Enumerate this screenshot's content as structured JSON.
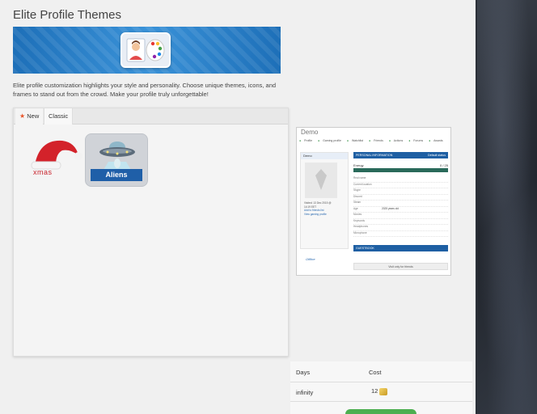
{
  "page": {
    "title": "Elite Profile Themes",
    "description": "Elite profile customization highlights your style and personality. Choose unique themes, icons, and frames to stand out from the crowd. Make your profile truly unforgettable!"
  },
  "tabs": [
    {
      "label": "New",
      "active": true
    },
    {
      "label": "Classic",
      "active": false
    }
  ],
  "themes": [
    {
      "label": "xmas",
      "icon": "santa-hat-icon"
    },
    {
      "label": "Aliens",
      "icon": "ufo-icon"
    }
  ],
  "demo": {
    "title": "Demo",
    "nav": [
      "Profile",
      "Gaming profile",
      "Watchlist",
      "Friends",
      "Actions",
      "Forums",
      "Awards"
    ],
    "side_name": "Demo",
    "side_info": [
      "Visited: 13 Dec 2015 @",
      "14:19 EET",
      "Add to friends list",
      "View gaming profile"
    ],
    "status": "Offline",
    "section_personal": "PERSONAL INFORMATION",
    "section_default": "Default status",
    "energy_label": "Energy",
    "energy_value": "0 / 25",
    "fields": [
      "Real name",
      "Current location",
      "Skype",
      "Discord",
      "Steam",
      "Age",
      "Movies",
      "Keywords",
      "Headphones",
      "Microphone"
    ],
    "age_value": "2025 years old",
    "guestbook": "GUESTBOOK",
    "guestbook_note": "Visit only for friends"
  },
  "pricing": {
    "col_days": "Days",
    "col_cost": "Cost",
    "rows": [
      {
        "days": "infinity",
        "cost": "12"
      }
    ],
    "currency_icon": "gold-coin-icon",
    "buy_color": "#4caf50"
  }
}
